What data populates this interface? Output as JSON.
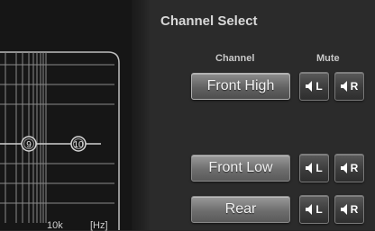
{
  "graph": {
    "hz_labels": [
      "10k",
      "[Hz]"
    ],
    "band_markers": [
      "9",
      "10"
    ]
  },
  "channel_select": {
    "title": "Channel Select",
    "headers": {
      "channel": "Channel",
      "mute": "Mute"
    },
    "channels": [
      {
        "label": "Front High",
        "mute_left": "L",
        "mute_right": "R",
        "selected": true
      },
      {
        "label": "Front Low",
        "mute_left": "L",
        "mute_right": "R",
        "selected": false
      },
      {
        "label": "Rear",
        "mute_left": "L",
        "mute_right": "R",
        "selected": false
      }
    ]
  },
  "colors": {
    "background": "#262626",
    "graph_background": "#161616",
    "grid_line": "#8a8a8a",
    "button_text": "#f2f2f2"
  },
  "icons": [
    "speaker-icon"
  ]
}
